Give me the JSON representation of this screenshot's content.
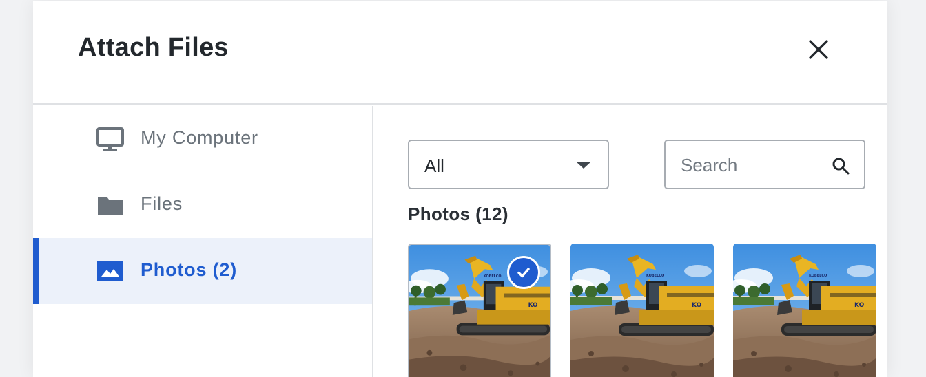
{
  "modal": {
    "title": "Attach Files",
    "close_icon": "close-icon"
  },
  "sidebar": {
    "items": [
      {
        "label": "My Computer",
        "icon": "monitor-icon",
        "active": false
      },
      {
        "label": "Files",
        "icon": "folder-icon",
        "active": false
      },
      {
        "label": "Photos (2)",
        "icon": "image-icon",
        "active": true
      }
    ]
  },
  "filters": {
    "type_select": {
      "selected": "All"
    },
    "search": {
      "placeholder": "Search",
      "value": ""
    }
  },
  "photos": {
    "section_title": "Photos (12)",
    "items": [
      {
        "name": "excavator-photo",
        "selected": true
      },
      {
        "name": "excavator-photo",
        "selected": false
      },
      {
        "name": "excavator-photo",
        "selected": false
      }
    ]
  },
  "colors": {
    "accent": "#1f5ccf",
    "active_bg": "#ecf1fa",
    "border": "#a7acb2",
    "text_primary": "#23282d",
    "text_muted": "#6b737b"
  }
}
